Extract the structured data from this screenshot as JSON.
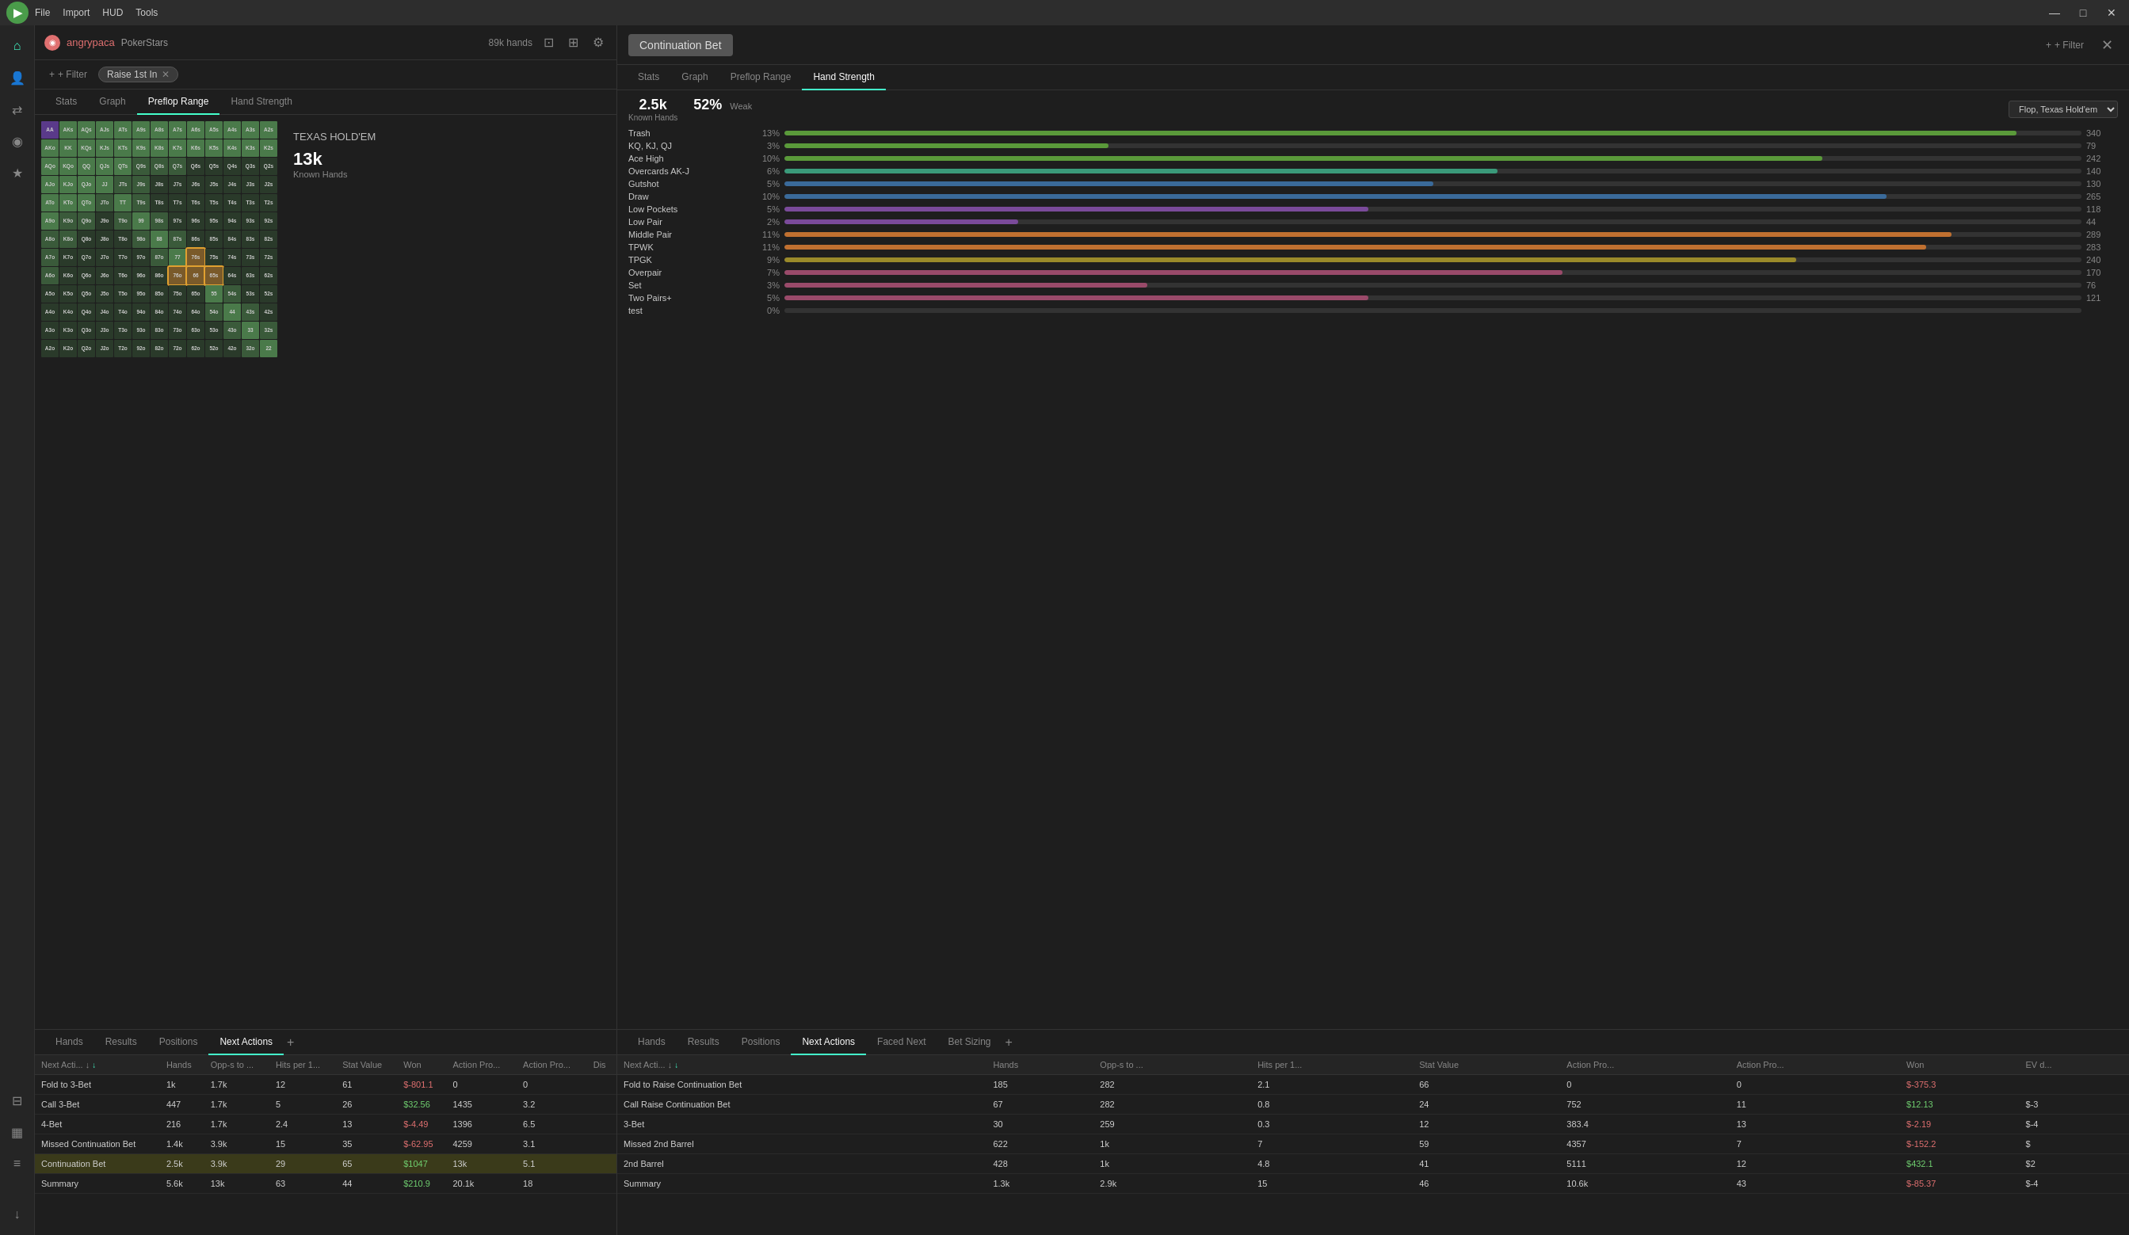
{
  "titleBar": {
    "menuItems": [
      "File",
      "Import",
      "HUD",
      "Tools"
    ],
    "controls": [
      "—",
      "□",
      "✕"
    ]
  },
  "sidebar": {
    "icons": [
      {
        "name": "home-icon",
        "symbol": "⌂",
        "active": true
      },
      {
        "name": "person-icon",
        "symbol": "👤"
      },
      {
        "name": "share-icon",
        "symbol": "⇄"
      },
      {
        "name": "radio-icon",
        "symbol": "◎"
      },
      {
        "name": "star-icon",
        "symbol": "★"
      },
      {
        "name": "filter-icon",
        "symbol": "⊞"
      },
      {
        "name": "grid-icon",
        "symbol": "▦"
      },
      {
        "name": "layers-icon",
        "symbol": "≡"
      },
      {
        "name": "download-icon",
        "symbol": "↓"
      }
    ]
  },
  "leftPanel": {
    "player": {
      "name": "angrypaca",
      "site": "PokerStars",
      "hands": "89k hands"
    },
    "filters": {
      "addLabel": "+ Filter",
      "chips": [
        "Raise 1st In"
      ]
    },
    "tabs": [
      "Stats",
      "Graph",
      "Preflop Range",
      "Hand Strength"
    ],
    "activeTab": "Preflop Range",
    "rangeInfo": {
      "gameType": "TEXAS HOLD'EM",
      "hands": "13k",
      "knownHandsLabel": "Known Hands"
    },
    "bottomTabs": [
      "Hands",
      "Results",
      "Positions",
      "Next Actions"
    ],
    "activeBottomTab": "Next Actions",
    "tableHeaders": [
      "Next Acti... ↓",
      "Hands",
      "Opp-s to ...",
      "Hits per 1...",
      "Stat Value",
      "Won",
      "Action Pro...",
      "Action Pro...",
      "Dis"
    ],
    "tableRows": [
      {
        "action": "Fold to 3-Bet",
        "hands": "1k",
        "opp": "1.7k",
        "hits": "12",
        "statVal": "61",
        "won": "$-801.1",
        "ap1": "0",
        "ap2": "0",
        "dis": "",
        "highlight": false,
        "wonClass": "val-negative"
      },
      {
        "action": "Call 3-Bet",
        "hands": "447",
        "opp": "1.7k",
        "hits": "5",
        "statVal": "26",
        "won": "$32.56",
        "ap1": "1435",
        "ap2": "3.2",
        "dis": "",
        "highlight": false,
        "wonClass": "val-positive"
      },
      {
        "action": "4-Bet",
        "hands": "216",
        "opp": "1.7k",
        "hits": "2.4",
        "statVal": "13",
        "won": "$-4.49",
        "ap1": "1396",
        "ap2": "6.5",
        "dis": "",
        "highlight": false,
        "wonClass": "val-negative"
      },
      {
        "action": "Missed Continuation Bet",
        "hands": "1.4k",
        "opp": "3.9k",
        "hits": "15",
        "statVal": "35",
        "won": "$-62.95",
        "ap1": "4259",
        "ap2": "3.1",
        "dis": "",
        "highlight": false,
        "wonClass": "val-negative"
      },
      {
        "action": "Continuation Bet",
        "hands": "2.5k",
        "opp": "3.9k",
        "hits": "29",
        "statVal": "65",
        "won": "$1047",
        "ap1": "13k",
        "ap2": "5.1",
        "dis": "",
        "highlight": true,
        "wonClass": "val-positive"
      },
      {
        "action": "Summary",
        "hands": "5.6k",
        "opp": "13k",
        "hits": "63",
        "statVal": "44",
        "won": "$210.9",
        "ap1": "20.1k",
        "ap2": "18",
        "dis": "",
        "highlight": false,
        "wonClass": "val-positive"
      }
    ]
  },
  "rightPanel": {
    "title": "Continuation Bet",
    "filterLabel": "+ Filter",
    "tabs": [
      "Stats",
      "Graph",
      "Preflop Range",
      "Hand Strength"
    ],
    "activeTab": "Hand Strength",
    "handStrength": {
      "knownHands": "2.5k",
      "knownHandsLabel": "Known Hands",
      "pct": "52%",
      "weakLabel": "Weak",
      "flopDropdown": "Flop, Texas Hold'em",
      "rows": [
        {
          "label": "Trash",
          "pct": "13%",
          "barColor": "bar-green",
          "barWidth": 95,
          "count": "340"
        },
        {
          "label": "KQ, KJ, QJ",
          "pct": "3%",
          "barColor": "bar-green",
          "barWidth": 25,
          "count": "79"
        },
        {
          "label": "Ace High",
          "pct": "10%",
          "barColor": "bar-green",
          "barWidth": 80,
          "count": "242"
        },
        {
          "label": "Overcards AK-J",
          "pct": "6%",
          "barColor": "bar-teal",
          "barWidth": 55,
          "count": "140"
        },
        {
          "label": "Gutshot",
          "pct": "5%",
          "barColor": "bar-blue",
          "barWidth": 50,
          "count": "130"
        },
        {
          "label": "Draw",
          "pct": "10%",
          "barColor": "bar-blue",
          "barWidth": 85,
          "count": "265"
        },
        {
          "label": "Low Pockets",
          "pct": "5%",
          "barColor": "bar-purple",
          "barWidth": 45,
          "count": "118"
        },
        {
          "label": "Low Pair",
          "pct": "2%",
          "barColor": "bar-purple",
          "barWidth": 18,
          "count": "44"
        },
        {
          "label": "Middle Pair",
          "pct": "11%",
          "barColor": "bar-orange",
          "barWidth": 90,
          "count": "289"
        },
        {
          "label": "TPWK",
          "pct": "11%",
          "barColor": "bar-orange",
          "barWidth": 88,
          "count": "283"
        },
        {
          "label": "TPGK",
          "pct": "9%",
          "barColor": "bar-yellow",
          "barWidth": 78,
          "count": "240"
        },
        {
          "label": "Overpair",
          "pct": "7%",
          "barColor": "bar-pink",
          "barWidth": 60,
          "count": "170"
        },
        {
          "label": "Set",
          "pct": "3%",
          "barColor": "bar-pink",
          "barWidth": 28,
          "count": "76"
        },
        {
          "label": "Two Pairs+",
          "pct": "5%",
          "barColor": "bar-pink",
          "barWidth": 45,
          "count": "121"
        },
        {
          "label": "test",
          "pct": "0%",
          "barColor": "bar-green",
          "barWidth": 0,
          "count": ""
        }
      ]
    },
    "bottomTabs": [
      "Hands",
      "Results",
      "Positions",
      "Next Actions",
      "Faced Next",
      "Bet Sizing"
    ],
    "activeBottomTab": "Next Actions",
    "tableHeaders": [
      "Next Acti... ↓",
      "Hands",
      "Opp-s to ...",
      "Hits per 1...",
      "Stat Value",
      "Action Pro...",
      "Action Pro...",
      "Won",
      "EV d..."
    ],
    "tableRows": [
      {
        "action": "Fold to Raise Continuation Bet",
        "hands": "185",
        "opp": "282",
        "hits": "2.1",
        "statVal": "66",
        "ap1": "0",
        "ap2": "0",
        "won": "$-375.3",
        "ev": "",
        "wonClass": "val-negative"
      },
      {
        "action": "Call Raise Continuation Bet",
        "hands": "67",
        "opp": "282",
        "hits": "0.8",
        "statVal": "24",
        "ap1": "752",
        "ap2": "11",
        "won": "$12.13",
        "ev": "$-3",
        "wonClass": "val-positive"
      },
      {
        "action": "3-Bet",
        "hands": "30",
        "opp": "259",
        "hits": "0.3",
        "statVal": "12",
        "ap1": "383.4",
        "ap2": "13",
        "won": "$-2.19",
        "ev": "$-4",
        "wonClass": "val-negative"
      },
      {
        "action": "Missed 2nd Barrel",
        "hands": "622",
        "opp": "1k",
        "hits": "7",
        "statVal": "59",
        "ap1": "4357",
        "ap2": "7",
        "won": "$-152.2",
        "ev": "$",
        "wonClass": "val-negative"
      },
      {
        "action": "2nd Barrel",
        "hands": "428",
        "opp": "1k",
        "hits": "4.8",
        "statVal": "41",
        "ap1": "5111",
        "ap2": "12",
        "won": "$432.1",
        "ev": "$2",
        "wonClass": "val-positive"
      },
      {
        "action": "Summary",
        "hands": "1.3k",
        "opp": "2.9k",
        "hits": "15",
        "statVal": "46",
        "ap1": "10.6k",
        "ap2": "43",
        "won": "$-85.37",
        "ev": "$-4",
        "wonClass": "val-negative"
      }
    ]
  },
  "gridData": {
    "ranks": [
      "A",
      "K",
      "Q",
      "J",
      "T",
      "9",
      "8",
      "7",
      "6",
      "5",
      "4",
      "3",
      "2"
    ],
    "cells": []
  }
}
